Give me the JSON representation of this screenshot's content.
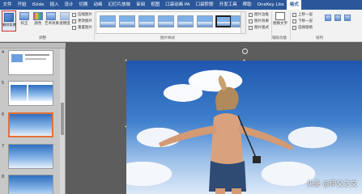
{
  "menu": {
    "file": "文件",
    "tabs": [
      "开始",
      "iSlide",
      "插入",
      "设计",
      "切换",
      "动画",
      "幻灯片放映",
      "审阅",
      "视图",
      "口袋动画 PA",
      "口袋阶联",
      "开发工具",
      "帮助",
      "OneKey Lite",
      "格式"
    ],
    "active_index": 14
  },
  "ribbon": {
    "remove_bg": "删除背景",
    "corrections": "校正",
    "color": "颜色",
    "artistic": "艺术效果",
    "transparency": "透明度",
    "compress": "压缩图片",
    "change": "更改图片",
    "reset": "重置图片",
    "adjust_label": "调整",
    "styles_label": "图片样式",
    "border": "图片边框",
    "effects": "图片效果",
    "layout": "图片版式",
    "alt_text": "替换文字",
    "accessibility_label": "辅助功能",
    "bring_forward": "上移一层",
    "send_backward": "下移一层",
    "selection_pane": "选择窗格",
    "arrange_label": "排列"
  },
  "thumbnails": {
    "numbers": [
      "4",
      "5",
      "6",
      "7",
      "8"
    ],
    "selected_index": 2
  },
  "watermark": "头条 @伊父之文",
  "colors": {
    "ribbon_blue": "#2b579a",
    "selection_orange": "#e2723a",
    "highlight_red": "#e03030"
  }
}
